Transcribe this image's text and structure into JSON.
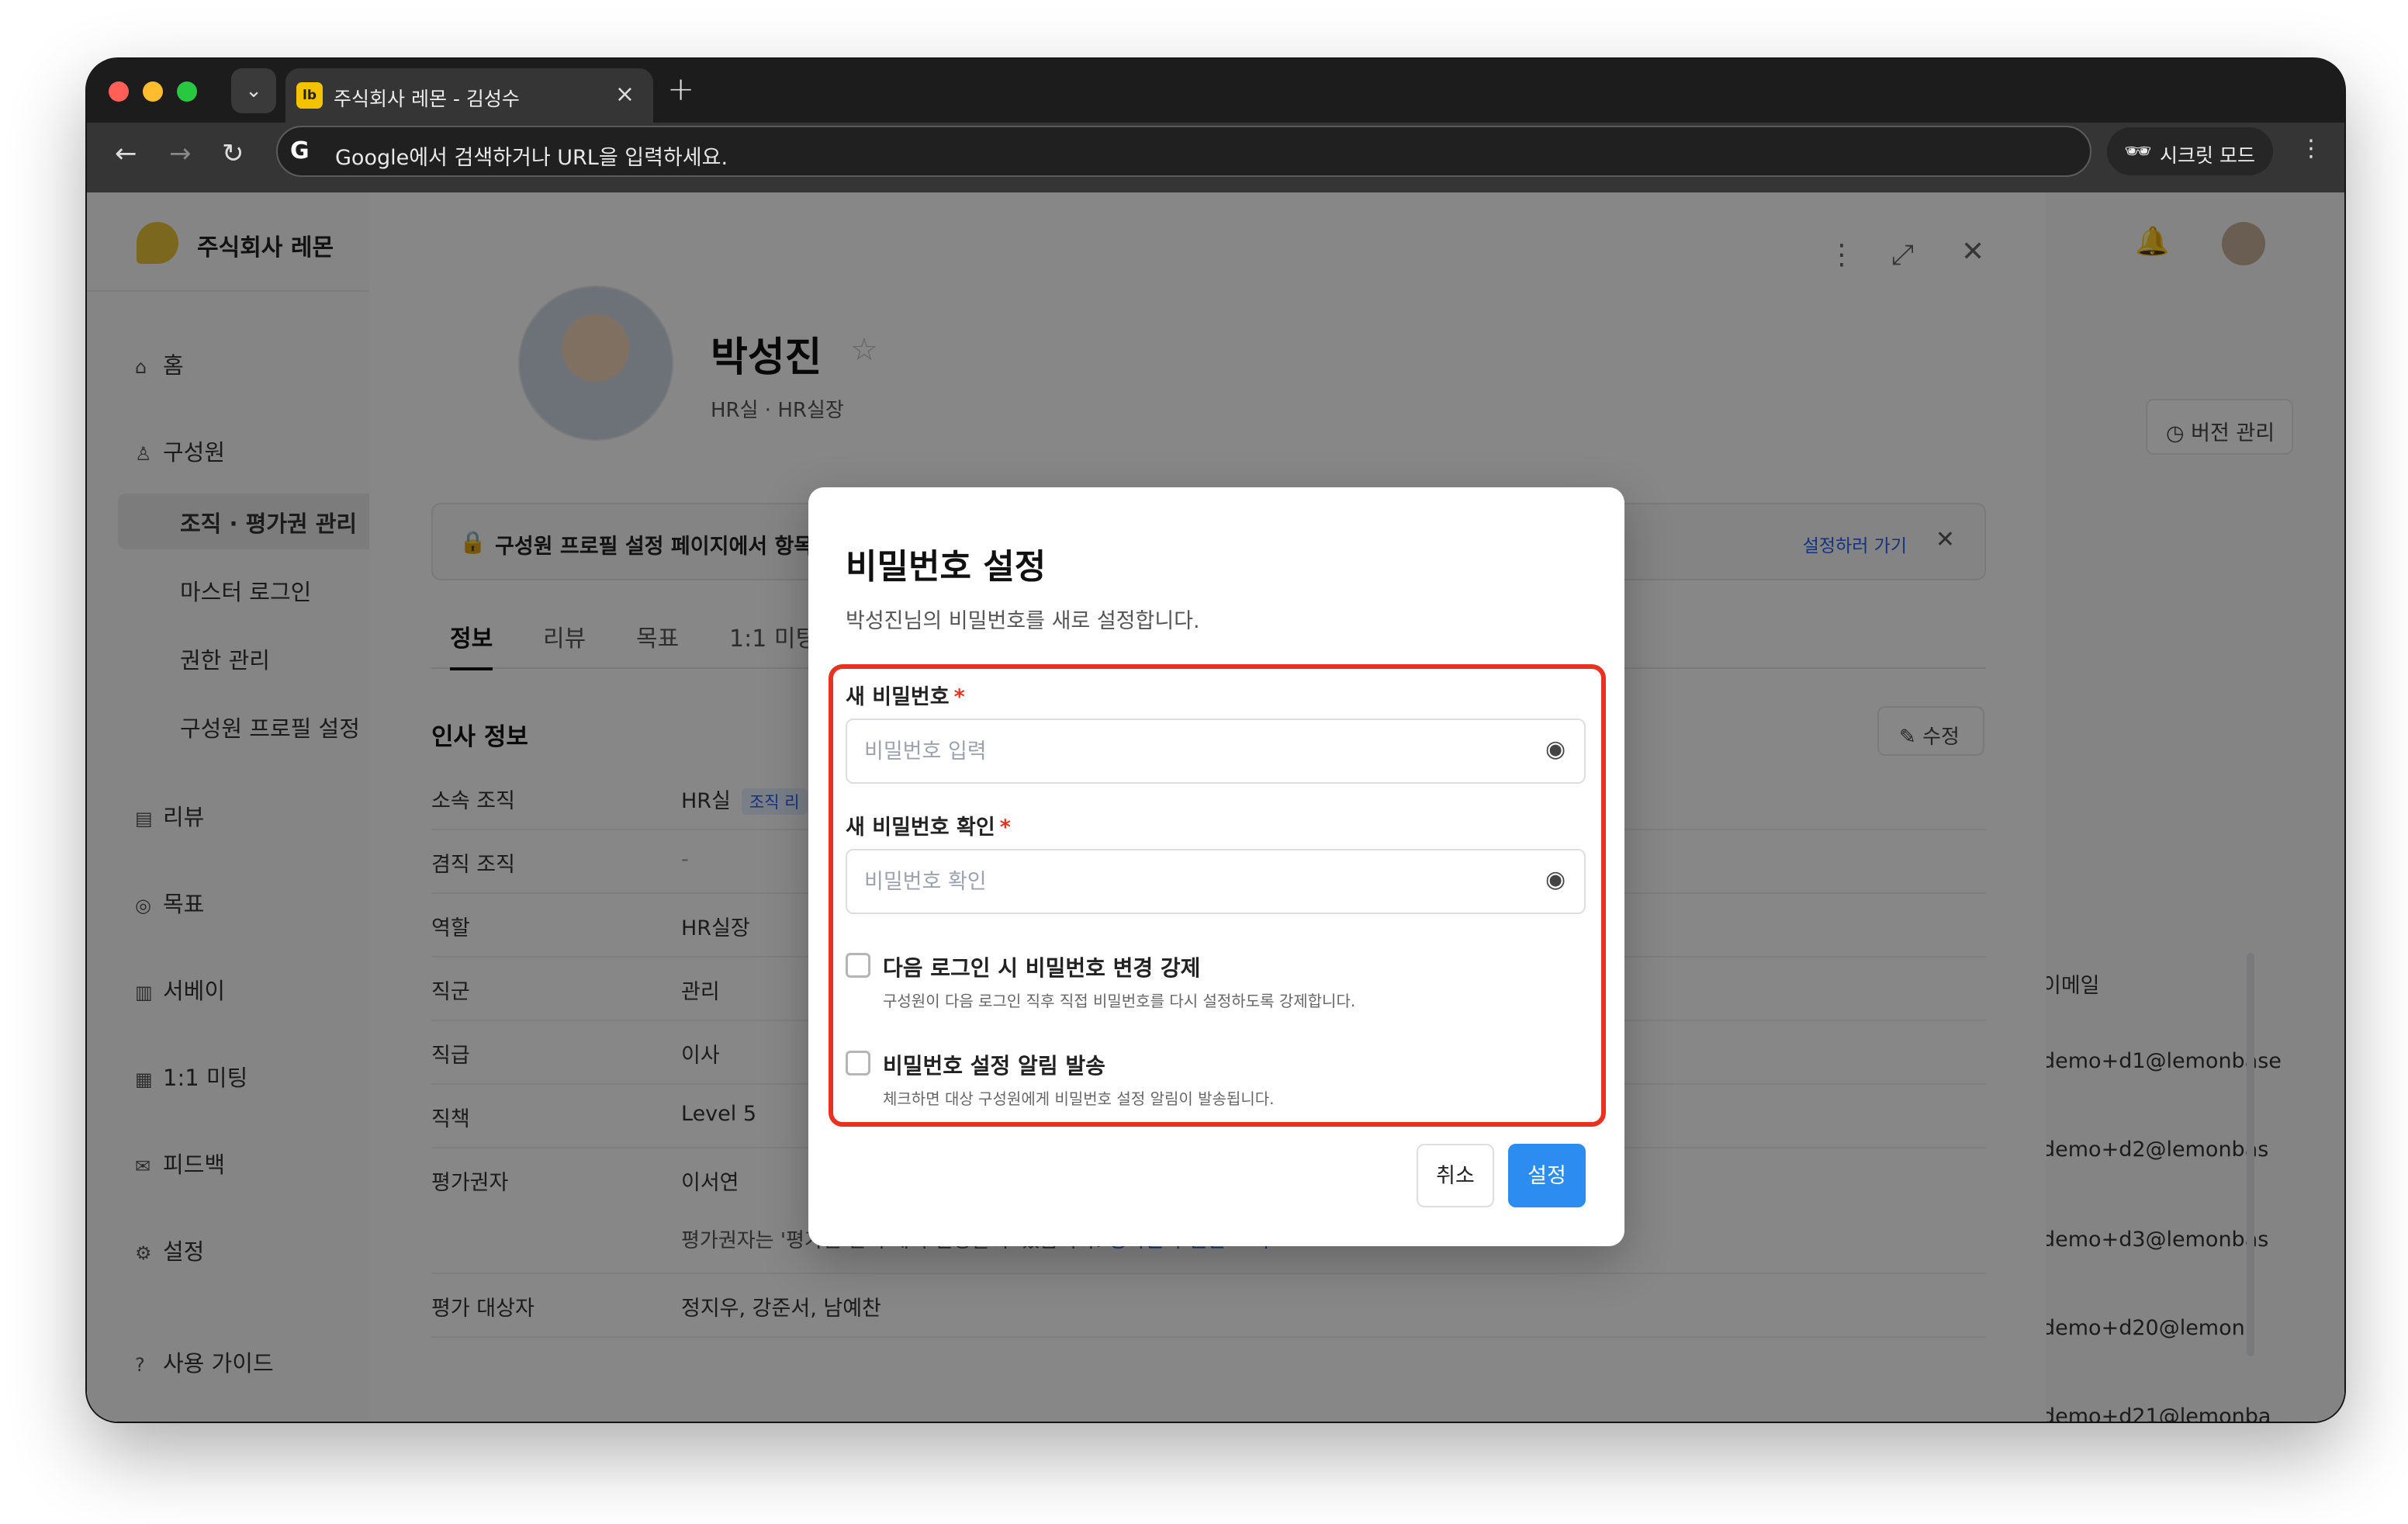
{
  "browser": {
    "tab_title": "주식회사 레몬 - 김성수",
    "tab_favicon": "lb",
    "url_placeholder": "Google에서 검색하거나 URL을 입력하세요.",
    "incognito_label": "시크릿 모드"
  },
  "sidebar": {
    "brand": "주식회사 레몬",
    "items": [
      {
        "icon": "home-icon",
        "label": "홈"
      },
      {
        "icon": "person-icon",
        "label": "구성원"
      },
      {
        "label": "조직 · 평가권 관리",
        "active": true
      },
      {
        "label": "마스터 로그인"
      },
      {
        "label": "권한 관리"
      },
      {
        "label": "구성원 프로필 설정"
      },
      {
        "icon": "document-icon",
        "label": "리뷰"
      },
      {
        "icon": "target-icon",
        "label": "목표"
      },
      {
        "icon": "chart-icon",
        "label": "서베이"
      },
      {
        "icon": "calendar-icon",
        "label": "1:1 미팅"
      },
      {
        "icon": "mail-icon",
        "label": "피드백"
      },
      {
        "icon": "gear-icon",
        "label": "설정"
      },
      {
        "icon": "help-circle-icon",
        "label": "사용 가이드"
      }
    ]
  },
  "profile": {
    "name": "박성진",
    "dept": "HR실 · HR실장",
    "version_button": "버전 관리",
    "notice": "구성원 프로필 설정 페이지에서 항목",
    "notice_link": "설정하러 가기",
    "tabs": [
      "정보",
      "리뷰",
      "목표",
      "1:1 미팅"
    ],
    "section_title": "인사 정보",
    "edit_button": "수정",
    "rows": [
      {
        "key": "소속 조직",
        "value": "HR실",
        "chip": "조직 리"
      },
      {
        "key": "겸직 조직",
        "value": "-"
      },
      {
        "key": "역할",
        "value": "HR실장"
      },
      {
        "key": "직군",
        "value": "관리"
      },
      {
        "key": "직급",
        "value": "이사"
      },
      {
        "key": "직책",
        "value": "Level 5"
      },
      {
        "key": "평가권자",
        "value": "이서연"
      },
      {
        "key": "평가 대상자",
        "value": "정지우, 강준서, 남예찬"
      }
    ],
    "evaluator_hint": "평가권자는 '평가권 관리'에서 설정할 수 있습니다.",
    "evaluator_hint_link": "평가권자 권한 보기"
  },
  "background_list": {
    "email_header": "이메일",
    "emails": [
      "demo+d1@lemonbase",
      "demo+d2@lemonbas",
      "demo+d3@lemonbas",
      "demo+d20@lemon",
      "demo+d21@lemonba"
    ]
  },
  "modal": {
    "title": "비밀번호 설정",
    "description": "박성진님의 비밀번호를 새로 설정합니다.",
    "new_password_label": "새 비밀번호",
    "new_password_placeholder": "비밀번호 입력",
    "confirm_password_label": "새 비밀번호 확인",
    "confirm_password_placeholder": "비밀번호 확인",
    "required_mark": "*",
    "force_change_label": "다음 로그인 시 비밀번호 변경 강제",
    "force_change_desc": "구성원이 다음 로그인 직후 직접 비밀번호를 다시 설정하도록 강제합니다.",
    "notify_label": "비밀번호 설정 알림 발송",
    "notify_desc": "체크하면 대상 구성원에게 비밀번호 설정 알림이 발송됩니다.",
    "cancel_button": "취소",
    "submit_button": "설정"
  },
  "colors": {
    "highlight_border": "#e8311f",
    "primary_button": "#2d8cf0",
    "link": "#2563eb"
  }
}
